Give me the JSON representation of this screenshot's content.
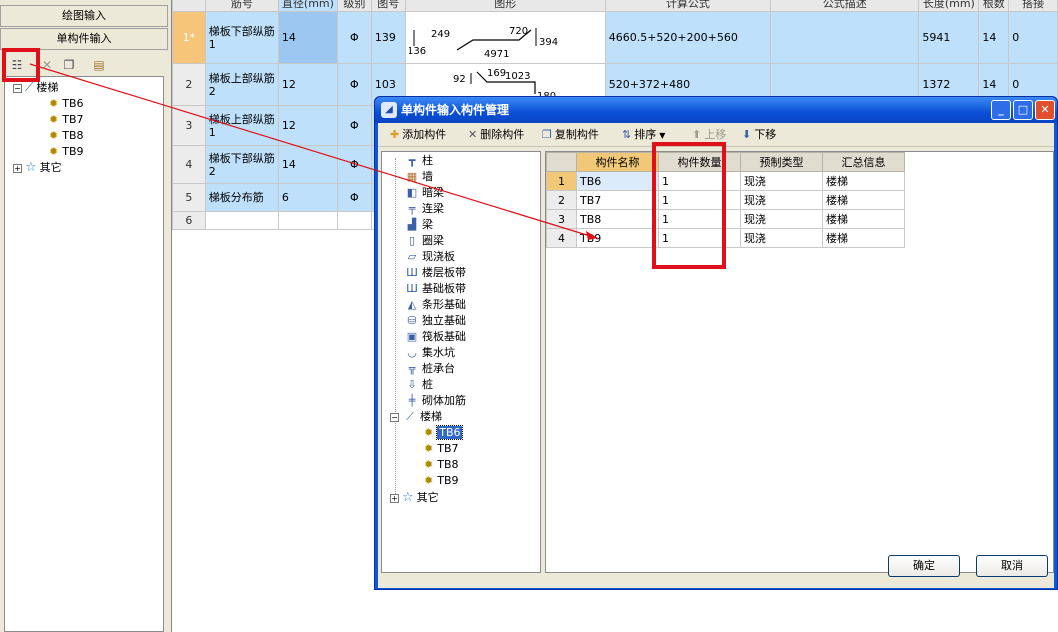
{
  "left_panel": {
    "tab_draw": "绘图输入",
    "tab_single": "单构件输入",
    "tree": {
      "root": "楼梯",
      "children": [
        "TB6",
        "TB7",
        "TB8",
        "TB9"
      ],
      "other": "其它"
    }
  },
  "grid": {
    "headers": [
      "",
      "筋号",
      "直径(mm)",
      "级别",
      "图号",
      "图形",
      "计算公式",
      "公式描述",
      "长度(mm)",
      "根数",
      "搭接"
    ],
    "rows": [
      {
        "num": "1*",
        "name": "梯板下部纵筋1",
        "dia": "14",
        "grade": "Φ",
        "fig": "139",
        "shape": [
          "136",
          "249",
          "720",
          "394",
          "4971"
        ],
        "formula": "4660.5+520+200+560",
        "desc": "",
        "len": "5941",
        "count": "14",
        "lap": "0"
      },
      {
        "num": "2",
        "name": "梯板上部纵筋2",
        "dia": "12",
        "grade": "Φ",
        "fig": "103",
        "shape": [
          "92",
          "169",
          "1023",
          "180"
        ],
        "formula": "520+372+480",
        "desc": "",
        "len": "1372",
        "count": "14",
        "lap": "0"
      },
      {
        "num": "3",
        "name": "梯板上部纵筋1",
        "dia": "12",
        "grade": "Φ",
        "fig": "",
        "shape": [],
        "formula": "",
        "desc": "",
        "len": "",
        "count": "",
        "lap": ""
      },
      {
        "num": "4",
        "name": "梯板下部纵筋2",
        "dia": "14",
        "grade": "Φ",
        "fig": "",
        "shape": [],
        "formula": "",
        "desc": "",
        "len": "",
        "count": "",
        "lap": ""
      },
      {
        "num": "5",
        "name": "梯板分布筋",
        "dia": "6",
        "grade": "Φ",
        "fig": "",
        "shape": [],
        "formula": "",
        "desc": "",
        "len": "",
        "count": "",
        "lap": ""
      },
      {
        "num": "6",
        "name": "",
        "dia": "",
        "grade": "",
        "fig": "",
        "shape": [],
        "formula": "",
        "desc": "",
        "len": "",
        "count": "",
        "lap": ""
      }
    ]
  },
  "dialog": {
    "title": "单构件输入构件管理",
    "toolbar": {
      "add": "添加构件",
      "delete": "删除构件",
      "copy": "复制构件",
      "sort": "排序",
      "up": "上移",
      "down": "下移"
    },
    "tree": [
      "柱",
      "墙",
      "暗梁",
      "连梁",
      "梁",
      "圈梁",
      "现浇板",
      "楼层板带",
      "基础板带",
      "条形基础",
      "独立基础",
      "筏板基础",
      "集水坑",
      "桩承台",
      "桩",
      "砌体加筋",
      "楼梯",
      "TB6",
      "TB7",
      "TB8",
      "TB9",
      "其它"
    ],
    "columns": [
      "构件名称",
      "构件数量",
      "预制类型",
      "汇总信息"
    ],
    "rows": [
      {
        "rn": "1",
        "name": "TB6",
        "qty": "1",
        "type": "现浇",
        "sum": "楼梯"
      },
      {
        "rn": "2",
        "name": "TB7",
        "qty": "1",
        "type": "现浇",
        "sum": "楼梯"
      },
      {
        "rn": "3",
        "name": "TB8",
        "qty": "1",
        "type": "现浇",
        "sum": "楼梯"
      },
      {
        "rn": "4",
        "name": "TB9",
        "qty": "1",
        "type": "现浇",
        "sum": "楼梯"
      }
    ],
    "ok": "确定",
    "cancel": "取消"
  },
  "colors": {
    "annotation_red": "#e0101a",
    "title_blue": "#0a4fd6",
    "row_selected": "#bfe0fb"
  }
}
